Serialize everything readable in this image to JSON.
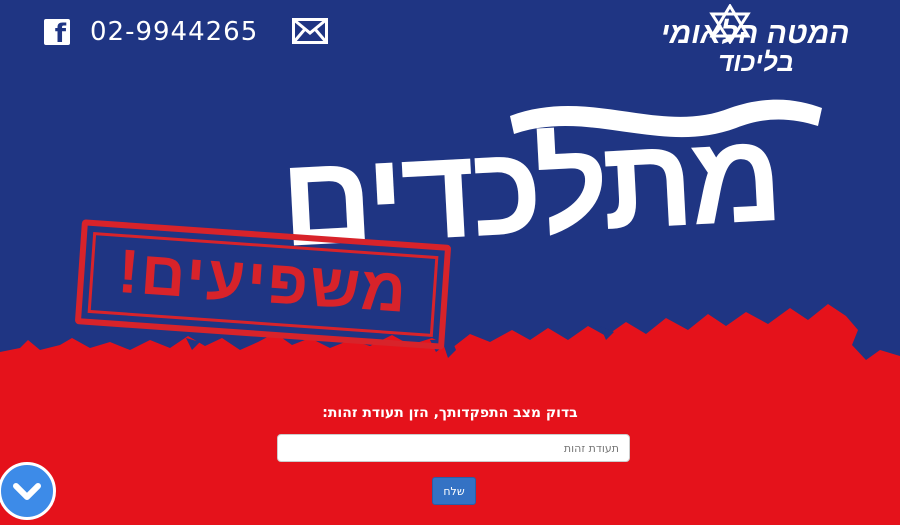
{
  "header": {
    "facebook_icon": "facebook-icon",
    "phone": "02-9944265",
    "mail_icon": "mail-icon"
  },
  "logo": {
    "line1": "המטה הלאומי",
    "line2": "בליכוד"
  },
  "hero": {
    "headline": "מתלכדים",
    "stamp": "משפיעים!"
  },
  "form": {
    "prompt": "בדוק מצב התפקדותך, הזן תעודת זהות:",
    "id_placeholder": "תעודת זהות",
    "id_value": "",
    "submit_label": "שלח"
  },
  "colors": {
    "blue": "#1f3583",
    "red": "#e5121b",
    "button": "#3472c4",
    "scroll_button": "#3d8be8"
  },
  "scroll_icon": "chevron-down-icon"
}
